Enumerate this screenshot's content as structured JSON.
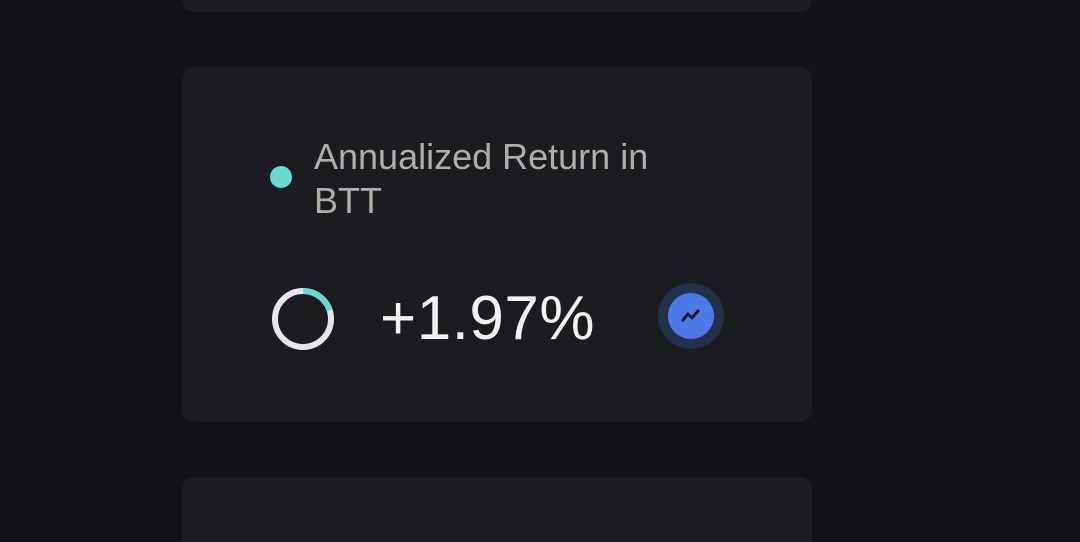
{
  "metric": {
    "label": "Annualized Return in BTT",
    "value": "+1.97%",
    "progress_fraction": 0.2,
    "legend_color": "#6ad9d6",
    "ring_track_color": "#e6e6e9",
    "ring_fill_color": "#6ad9d6",
    "trend_icon": "trend-chart-icon",
    "trend_color": "#4c79e6"
  }
}
